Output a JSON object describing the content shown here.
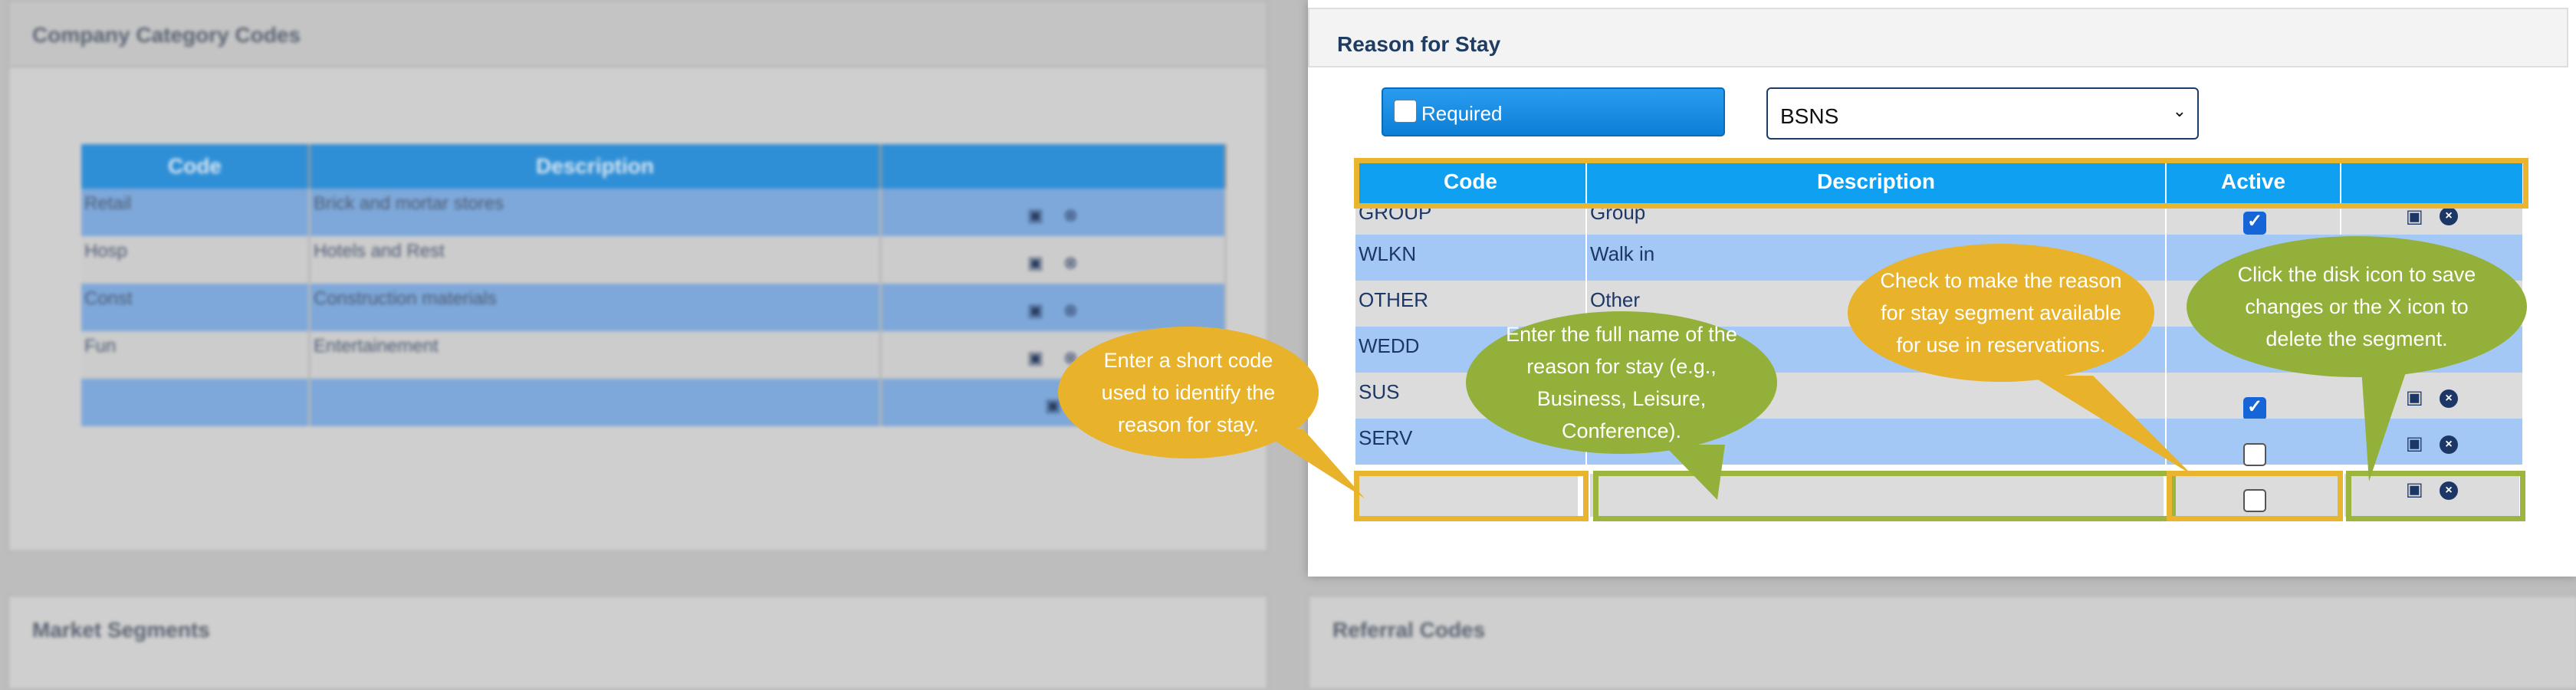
{
  "background": {
    "left_panel_title": "Company Category Codes",
    "table_headers": [
      "Code",
      "Description",
      ""
    ],
    "rows": [
      {
        "code": "Retail",
        "description": "Brick and mortar stores"
      },
      {
        "code": "Hosp",
        "description": "Hotels and Rest"
      },
      {
        "code": "Const",
        "description": "Construction materials"
      },
      {
        "code": "Fun",
        "description": "Entertainement"
      },
      {
        "code": "",
        "description": ""
      }
    ],
    "bottom_left_title": "Market Segments",
    "bottom_right_title": "Referral Codes"
  },
  "dialog": {
    "title": "Reason for Stay",
    "required_label": "Required",
    "select_value": "BSNS",
    "columns": [
      "Code",
      "Description",
      "Active",
      ""
    ],
    "rows": [
      {
        "code": "GROUP",
        "description": "Group",
        "active": true,
        "has_actions": true
      },
      {
        "code": "WLKN",
        "description": "Walk in",
        "active": null,
        "has_actions": false
      },
      {
        "code": "OTHER",
        "description": "Other",
        "active": null,
        "has_actions": false
      },
      {
        "code": "WEDD",
        "description": "",
        "active": null,
        "has_actions": false
      },
      {
        "code": "SUS",
        "description": "",
        "active": true,
        "has_actions": true
      },
      {
        "code": "SERV",
        "description": "",
        "active": false,
        "has_actions": true
      }
    ],
    "new_row": {
      "code": "",
      "description": "",
      "active": false
    }
  },
  "callouts": {
    "code": "Enter a short code used to identify the reason for stay.",
    "description": "Enter the full name of the reason for stay (e.g., Business, Leisure, Conference).",
    "active": "Check to make the reason for stay segment available for use in reservations.",
    "actions": "Click the disk icon to save changes or the X icon to delete the segment."
  },
  "colors": {
    "header_blue": "#10a0f2",
    "callout_yellow": "#e8b22a",
    "callout_green": "#93b03a",
    "row_blue": "#a4c8f5",
    "row_gray": "#dcdcdc"
  },
  "icons": {
    "save": "floppy-disk-icon",
    "delete": "x-circle-icon"
  }
}
